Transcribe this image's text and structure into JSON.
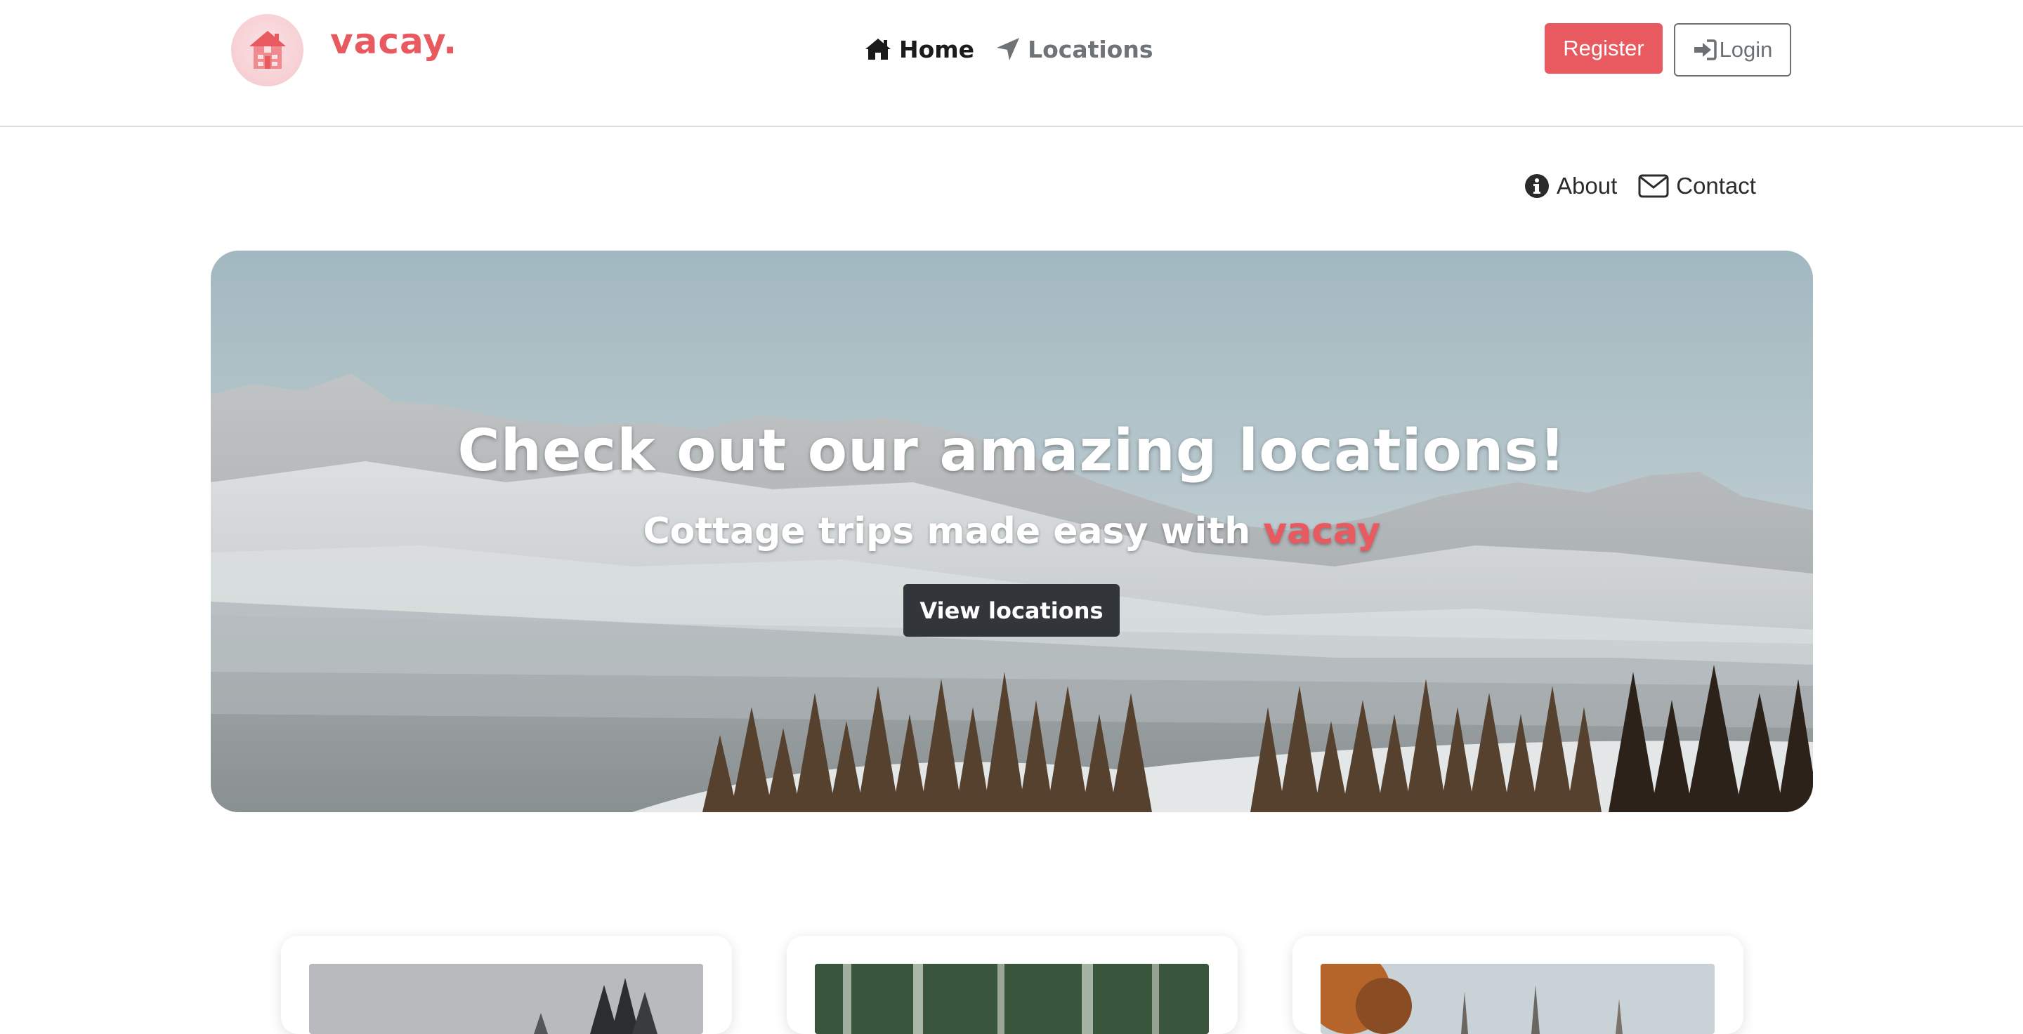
{
  "brand": {
    "name": "vacay.",
    "color": "#e85a5f",
    "logo_icon": "house-icon"
  },
  "nav": {
    "items": [
      {
        "label": "Home",
        "icon": "home-icon",
        "active": true
      },
      {
        "label": "Locations",
        "icon": "location-arrow-icon",
        "active": false
      }
    ]
  },
  "auth": {
    "register_label": "Register",
    "login_label": "Login",
    "login_icon": "sign-in-icon"
  },
  "subnav": {
    "about_label": "About",
    "about_icon": "info-circle-icon",
    "contact_label": "Contact",
    "contact_icon": "envelope-icon"
  },
  "hero": {
    "title": "Check out our amazing locations!",
    "subtitle_prefix": "Cottage trips made easy with ",
    "subtitle_accent": "vacay",
    "button_label": "View locations",
    "image": "snowy-mountain-range-with-pine-forest"
  },
  "cards": [
    {
      "image": "winter-pine-forest"
    },
    {
      "image": "green-forest"
    },
    {
      "image": "autumn-trees"
    }
  ],
  "colors": {
    "accent": "#e85a5f",
    "dark_button": "#32363a",
    "muted_text": "#6e7377"
  }
}
